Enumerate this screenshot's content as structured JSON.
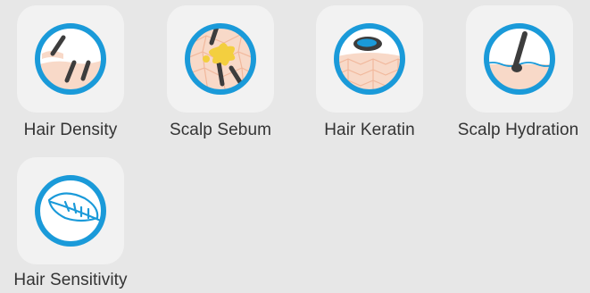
{
  "colors": {
    "ring": "#1a9ad9",
    "tile_bg": "#f2f2f2",
    "page_bg": "#e7e7e7",
    "skin": "#f8d9c8",
    "hair": "#3d3d3d",
    "sebum": "#f3cf3f",
    "label": "#333333"
  },
  "categories": [
    {
      "label": "Hair Density",
      "icon": "hair-density-icon"
    },
    {
      "label": "Scalp Sebum",
      "icon": "scalp-sebum-icon"
    },
    {
      "label": "Hair Keratin",
      "icon": "hair-keratin-icon"
    },
    {
      "label": "Scalp Hydration",
      "icon": "scalp-hydration-icon"
    },
    {
      "label": "Hair Sensitivity",
      "icon": "hair-sensitivity-icon"
    }
  ]
}
